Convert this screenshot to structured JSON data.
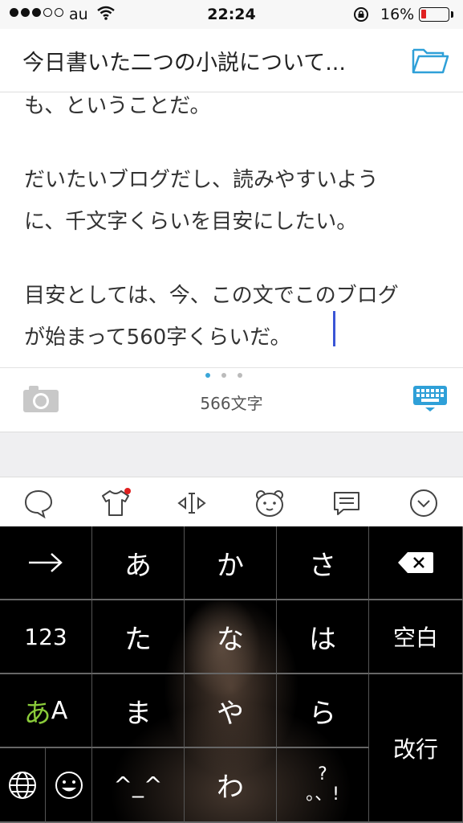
{
  "status": {
    "carrier": "au",
    "time": "22:24",
    "battery_pct": "16%",
    "battery_level": 0.16,
    "signal_bars_filled": 3,
    "signal_bars_total": 5
  },
  "header": {
    "title": "今日書いた二つの小説について...",
    "folder_icon": "folder-icon"
  },
  "editor": {
    "lines": [
      "も、ということだ。",
      "だいたいブログだし、読みやすいよう",
      "に、千文字くらいを目安にしたい。",
      "目安としては、今、この文でこのブログ",
      "が始まって560字くらいだ。"
    ]
  },
  "footer": {
    "char_count": "566文字",
    "page_dots": 3,
    "active_dot": 0,
    "camera_icon": "camera-icon",
    "keyboard_icon": "keyboard-icon"
  },
  "keyboard_toolbar": {
    "icons": [
      "speech-bubble-icon",
      "tshirt-icon",
      "cursor-move-icon",
      "bear-face-icon",
      "message-icon",
      "chevron-down-icon"
    ]
  },
  "keyboard": {
    "keys": {
      "arrow": "→",
      "a": "あ",
      "ka": "か",
      "sa": "さ",
      "delete": "⌫",
      "num": "123",
      "ta": "た",
      "na": "な",
      "ha": "は",
      "space": "空白",
      "mode_a": "あ",
      "mode_b": "A",
      "ma": "ま",
      "ya": "や",
      "ra": "ら",
      "enter": "改行",
      "kaomoji": "^_^",
      "wa": "わ",
      "punct": "?\n。、!"
    }
  },
  "colors": {
    "accent": "#3aa6d8",
    "caret": "#3a55d6",
    "battery_low": "#e02020",
    "mode_green": "#8acb3a"
  }
}
